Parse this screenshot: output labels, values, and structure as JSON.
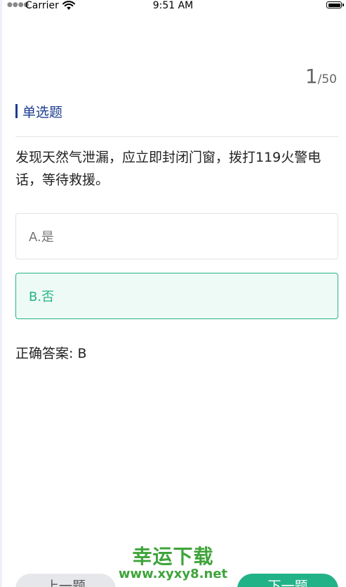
{
  "status_bar": {
    "signal": "●●●●",
    "carrier": "Carrier",
    "time": "9:51 AM"
  },
  "icons": {
    "wifi": "wifi-icon",
    "battery": "battery-icon"
  },
  "counter": {
    "current": "1",
    "total": "/50"
  },
  "question": {
    "type_label": "单选题",
    "text": "发现天然气泄漏，应立即封闭门窗，拨打119火警电话，等待救援。",
    "options": [
      {
        "label": "A.是",
        "state": "default"
      },
      {
        "label": "B.否",
        "state": "correct"
      }
    ],
    "answer": "正确答案: B"
  },
  "colors": {
    "accent_blue": "#1a3c8e",
    "correct_green": "#26b389",
    "next_button": "#22b288",
    "watermark_green": "#3fa43a"
  },
  "watermark": {
    "title": "幸运下载",
    "url": "www.xyxy8.net"
  },
  "nav": {
    "prev_label": "上一题",
    "next_label": "下一题"
  }
}
